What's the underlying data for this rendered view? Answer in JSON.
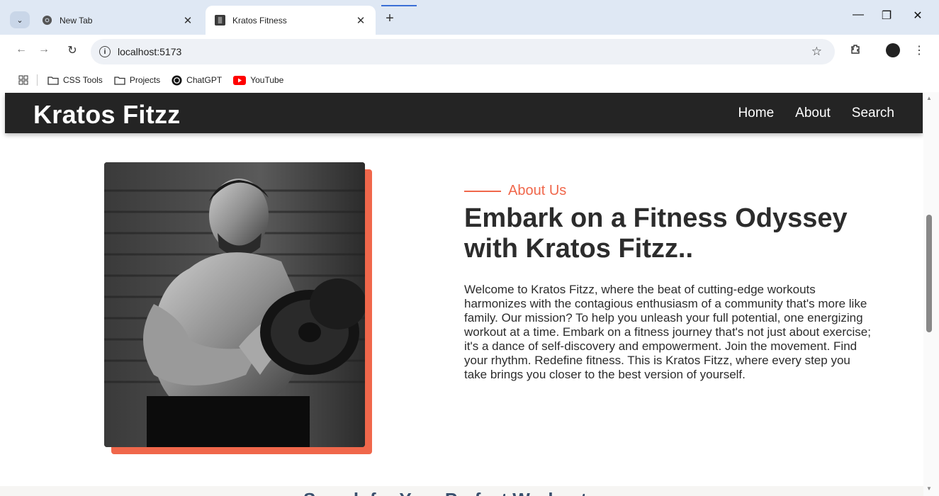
{
  "browser": {
    "tabs": [
      {
        "title": "New Tab",
        "icon": "chrome-icon"
      },
      {
        "title": "Kratos Fitness",
        "icon": "site-favicon"
      }
    ],
    "url": "localhost:5173",
    "bookmarks": [
      {
        "label": "CSS Tools",
        "icon": "folder-icon"
      },
      {
        "label": "Projects",
        "icon": "folder-icon"
      },
      {
        "label": "ChatGPT",
        "icon": "chatgpt-icon"
      },
      {
        "label": "YouTube",
        "icon": "youtube-icon"
      }
    ],
    "colors": {
      "tabbar": "#dfe8f4",
      "youtube_red": "#ff0000"
    }
  },
  "site": {
    "brand": "Kratos Fitzz",
    "nav": [
      "Home",
      "About",
      "Search"
    ],
    "about": {
      "eyebrow": "About Us",
      "headline": "Embark on a Fitness Odyssey with Kratos Fitzz..",
      "body": "Welcome to Kratos Fitzz, where the beat of cutting-edge workouts harmonizes with the contagious enthusiasm of a community that's more like family. Our mission? To help you unleash your full potential, one energizing workout at a time. Embark on a fitness journey that's not just about exercise; it's a dance of self-discovery and empowerment. Join the movement. Find your rhythm. Redefine fitness. This is Kratos Fitzz, where every step you take brings you closer to the best version of yourself."
    },
    "next_section_title": "Search for Your Perfect Workout",
    "colors": {
      "header_bg": "#242424",
      "accent": "#f0674b",
      "text": "#2c2c2c"
    }
  }
}
